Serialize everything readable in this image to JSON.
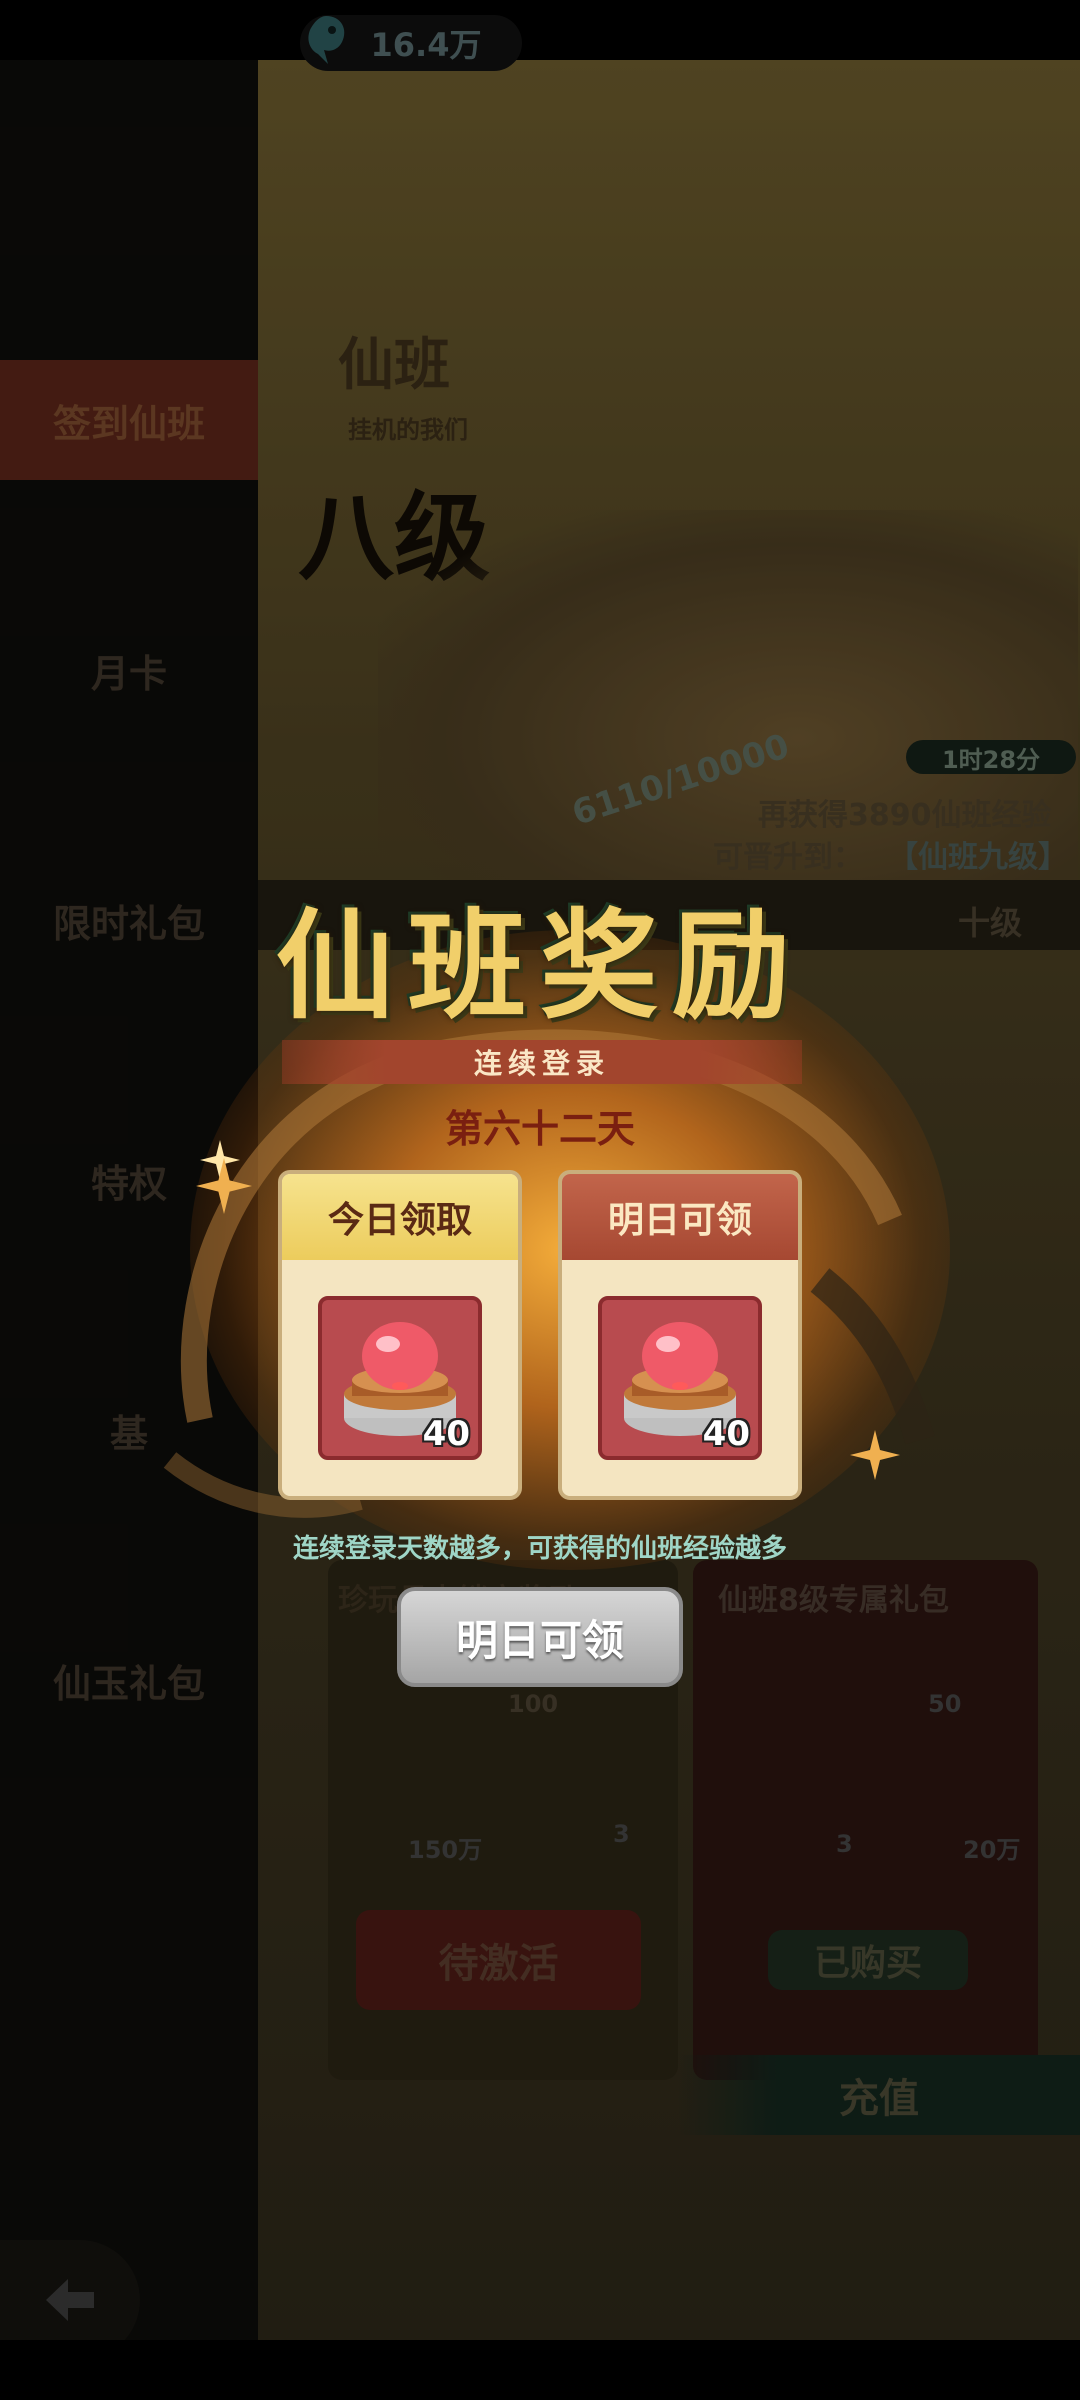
{
  "status_bar": {},
  "currency": {
    "amount": "16.4万",
    "icon": "fish-icon"
  },
  "sidebar": {
    "items": [
      {
        "label": "签到仙班",
        "active": true
      },
      {
        "label": "月卡"
      },
      {
        "label": "限时礼包"
      },
      {
        "label": "特权"
      },
      {
        "label": "基"
      },
      {
        "label": "仙玉礼包"
      }
    ]
  },
  "background": {
    "header_small": "仙班",
    "header_subtitle": "挂机的我们",
    "level_name": "八级",
    "progress_text": "6110/10000",
    "timer": "1时28分",
    "exp_line": "再获得3890仙班经验",
    "upgrade_label": "可晋升到：",
    "upgrade_target": "【仙班九级】",
    "tab_last": "十级",
    "gift_left_title": "珍玩月卡锁定奖励",
    "gift_right_title": "仙班8级专属礼包",
    "gift_values": {
      "a": "100",
      "b": "150万",
      "c": "3",
      "d": "50",
      "e": "3",
      "f": "20万"
    },
    "pending_btn": "待激活",
    "bought_btn": "已购买",
    "recharge_btn": "充值"
  },
  "popup": {
    "title": "仙班奖励",
    "banner": "连续登录",
    "day_label": "第六十二天",
    "cards": [
      {
        "header": "今日领取",
        "count": "40",
        "item_icon": "red-orb-on-pedestal-icon"
      },
      {
        "header": "明日可领",
        "count": "40",
        "item_icon": "red-orb-on-pedestal-icon"
      }
    ],
    "hint": "连续登录天数越多，可获得的仙班经验越多",
    "claim_button": "明日可领"
  },
  "colors": {
    "accent_gold": "#f1cf6a",
    "banner_red": "#a2452d",
    "hint_teal": "#9fd6c7",
    "button_gray": "#b5b5b5"
  }
}
